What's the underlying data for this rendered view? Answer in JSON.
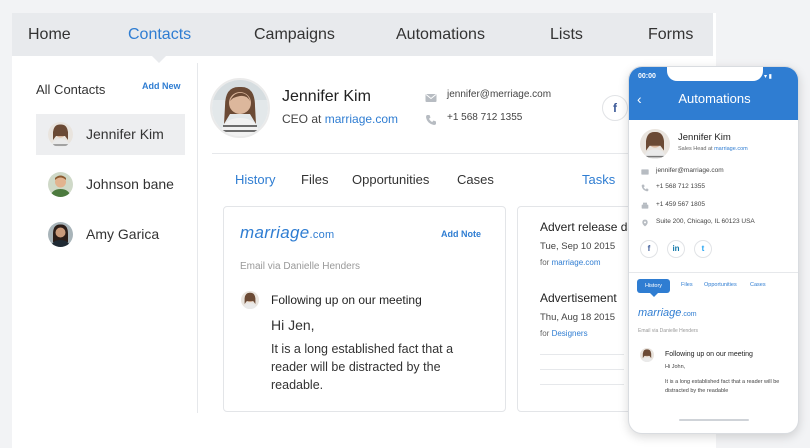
{
  "nav": {
    "items": [
      "Home",
      "Contacts",
      "Campaigns",
      "Automations",
      "Lists",
      "Forms"
    ],
    "active": "Contacts"
  },
  "sidebar": {
    "title": "All Contacts",
    "add_new": "Add New",
    "contacts": [
      "Jennifer Kim",
      "Johnson bane",
      "Amy Garica"
    ]
  },
  "profile": {
    "name": "Jennifer Kim",
    "role_prefix": "CEO at",
    "company": "marriage.com",
    "email": "jennifer@merriage.com",
    "phone": "+1 568 712 1355",
    "social_icon": "f"
  },
  "tabs": {
    "items": [
      "History",
      "Files",
      "Opportunities",
      "Cases"
    ],
    "active": "History",
    "right": "Tasks"
  },
  "history_card": {
    "logo_main": "marriage",
    "logo_suffix": ".com",
    "add_note": "Add Note",
    "email_via": "Email via Danielle Henders",
    "subject": "Following up on our meeting",
    "greeting": "Hi Jen,",
    "body": "It is a long established fact that a reader will be distracted by the readable."
  },
  "tasks_card": {
    "events": [
      {
        "title": "Advert release da",
        "date": "Tue, Sep 10 2015",
        "for_label": "for",
        "for_value": "marriage.com"
      },
      {
        "title": "Advertisement",
        "date": "Thu, Aug 18 2015",
        "for_label": "for",
        "for_value": "Designers"
      }
    ]
  },
  "phone": {
    "time": "00:00",
    "status": "▾ ▮",
    "back": "‹",
    "title": "Automations",
    "name": "Jennifer Kim",
    "role_prefix": "Sales Head at",
    "company": "marriage.com",
    "email": "jennifer@marriage.com",
    "phone1": "+1 568 712 1355",
    "phone2": "+1 459 567 1805",
    "address": "Suite 200, Chicago, IL 60123 USA",
    "social": [
      "f",
      "in",
      "t"
    ],
    "tabs": [
      "History",
      "Files",
      "Opportunities",
      "Cases"
    ],
    "logo_main": "marriage",
    "logo_suffix": ".com",
    "email_via": "Email via Danielle Henders",
    "subject": "Following up on our meeting",
    "greeting": "Hi John,",
    "body": "It is a long established fact that a reader will be distracted by the readable"
  },
  "colors": {
    "accent": "#2f7dd2",
    "nav_bg": "#e8eaed",
    "frame_bg": "#f2f3f5"
  },
  "icons": [
    "mail-icon",
    "phone-icon",
    "facebook-icon",
    "linkedin-icon",
    "twitter-icon",
    "location-icon",
    "back-arrow-icon"
  ]
}
